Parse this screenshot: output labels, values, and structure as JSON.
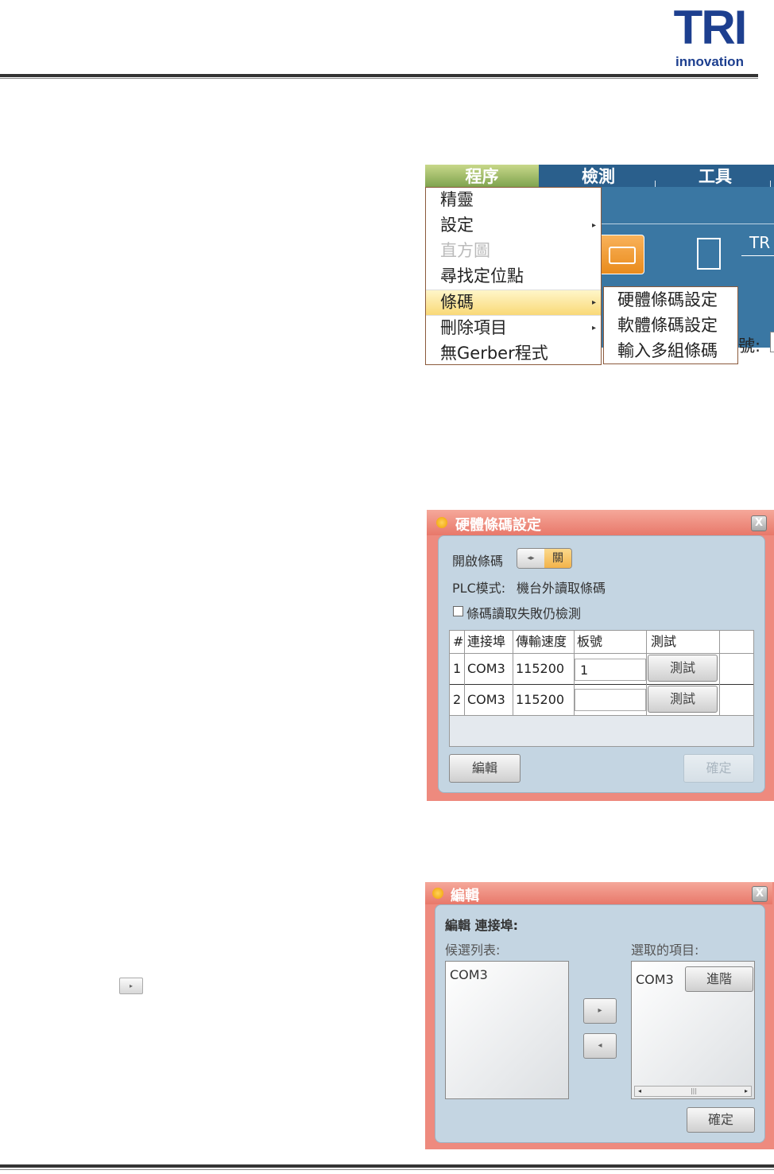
{
  "header": {
    "logo_main": "TRI",
    "logo_sub": "innovation"
  },
  "menu_screenshot": {
    "menubar": [
      "程序",
      "檢測",
      "工具"
    ],
    "menu_items": [
      {
        "label": "精靈",
        "submenu": false,
        "disabled": false
      },
      {
        "label": "設定",
        "submenu": true,
        "disabled": false
      },
      {
        "label": "直方圖",
        "submenu": false,
        "disabled": true
      },
      {
        "label": "尋找定位點",
        "submenu": false,
        "disabled": false
      },
      {
        "label": "條碼",
        "submenu": true,
        "disabled": false,
        "highlighted": true
      },
      {
        "label": "刪除項目",
        "submenu": true,
        "disabled": false
      },
      {
        "label": "無Gerber程式",
        "submenu": false,
        "disabled": false
      }
    ],
    "submenu_items": [
      "硬體條碼設定",
      "軟體條碼設定",
      "輸入多組條碼"
    ],
    "bg_label": "TR",
    "bg_field_label": "號:",
    "arrow_glyph": "▸"
  },
  "hardware_dialog": {
    "title": "硬體條碼設定",
    "close": "X",
    "enable_label": "開啟條碼",
    "toggle_knob": "◂▸",
    "toggle_state": "關",
    "plc_label": "PLC模式:",
    "plc_value": "機台外讀取條碼",
    "checkbox_label": "條碼讀取失敗仍檢測",
    "columns": [
      "#",
      "連接埠",
      "傳輸速度",
      "板號",
      "測試"
    ],
    "rows": [
      {
        "index": "1",
        "port": "COM3",
        "baud": "115200",
        "board": "1",
        "test": "測試"
      },
      {
        "index": "2",
        "port": "COM3",
        "baud": "115200",
        "board": "",
        "test": "測試"
      }
    ],
    "edit_button": "編輯",
    "ok_button": "確定"
  },
  "tiny_icon": "▸",
  "edit_dialog": {
    "title": "編輯",
    "close": "X",
    "heading": "編輯 連接埠:",
    "candidates_label": "候選列表:",
    "selected_label": "選取的項目:",
    "candidates": [
      "COM3"
    ],
    "selected": [
      "COM3"
    ],
    "advanced_button": "進階",
    "move_right": "▸",
    "move_left": "◂",
    "scroll_left": "◂",
    "scroll_right": "▸",
    "scroll_thumb": "|||",
    "ok_button": "確定"
  }
}
